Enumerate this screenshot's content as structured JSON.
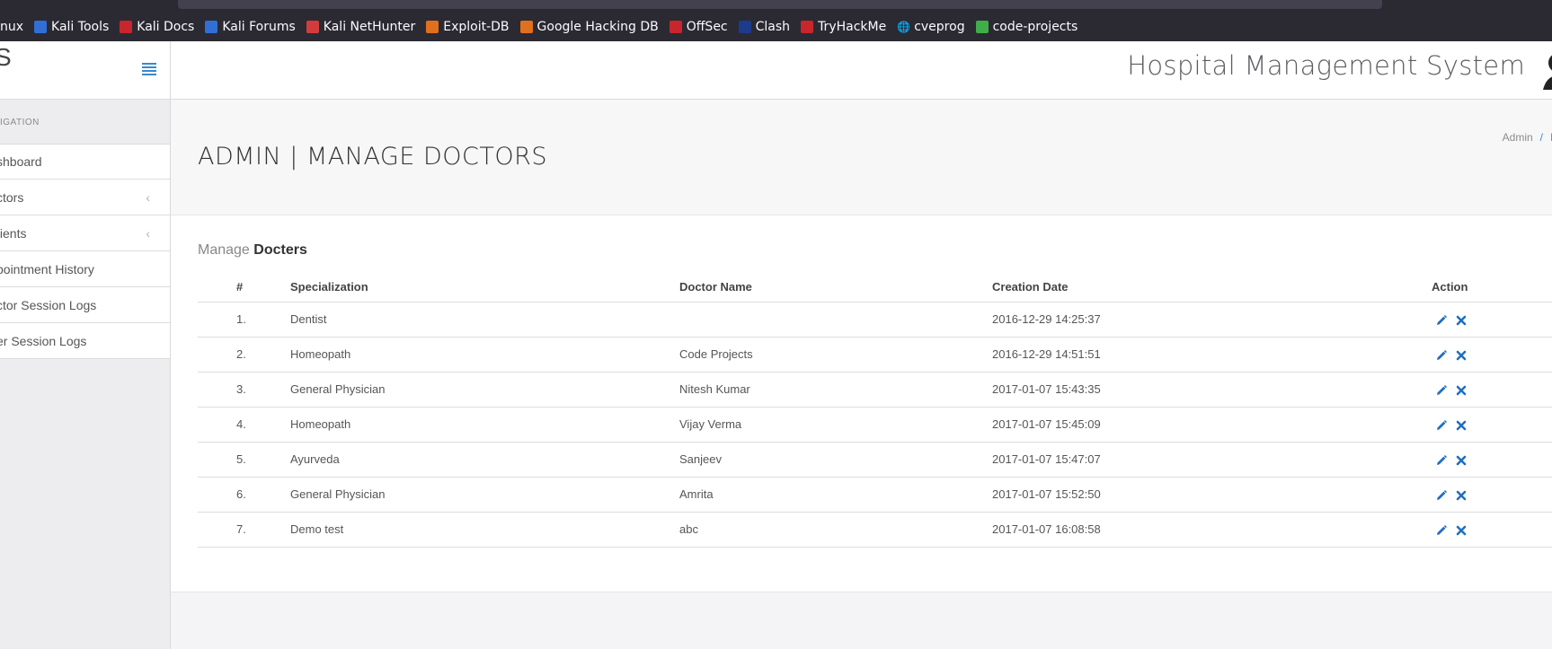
{
  "bookmarks": [
    {
      "label": "nux",
      "icon": "none",
      "color": ""
    },
    {
      "label": "Kali Tools",
      "icon": "kali-tools-icon",
      "color": "#2f6fd6"
    },
    {
      "label": "Kali Docs",
      "icon": "kali-docs-icon",
      "color": "#c9252c"
    },
    {
      "label": "Kali Forums",
      "icon": "kali-forums-icon",
      "color": "#2f6fd6"
    },
    {
      "label": "Kali NetHunter",
      "icon": "kali-nethunter-icon",
      "color": "#d33c3c"
    },
    {
      "label": "Exploit-DB",
      "icon": "exploit-db-icon",
      "color": "#e0701e"
    },
    {
      "label": "Google Hacking DB",
      "icon": "google-hacking-db-icon",
      "color": "#e0701e"
    },
    {
      "label": "OffSec",
      "icon": "offsec-icon",
      "color": "#c9252c"
    },
    {
      "label": "Clash",
      "icon": "clash-icon",
      "color": "#1d3b8c"
    },
    {
      "label": "TryHackMe",
      "icon": "tryhackme-icon",
      "color": "#c9252c"
    },
    {
      "label": "cveprog",
      "icon": "globe-icon",
      "color": "#fbfbfe"
    },
    {
      "label": "code-projects",
      "icon": "code-projects-icon",
      "color": "#3fae49"
    }
  ],
  "sidebar": {
    "brand_letter": "S",
    "nav_heading": "IGATION",
    "items": [
      {
        "label": "shboard",
        "has_chevron": false
      },
      {
        "label": "ctors",
        "has_chevron": true
      },
      {
        "label": "tients",
        "has_chevron": true
      },
      {
        "label": "pointment History",
        "has_chevron": false
      },
      {
        "label": "ctor Session Logs",
        "has_chevron": false
      },
      {
        "label": "er Session Logs",
        "has_chevron": false
      }
    ]
  },
  "header": {
    "app_title": "Hospital Management System"
  },
  "page": {
    "title": "ADMIN | MANAGE DOCTORS",
    "breadcrumb": {
      "first": "Admin",
      "separator": "/",
      "second": "M"
    }
  },
  "panel": {
    "heading_light": "Manage",
    "heading_bold": "Docters"
  },
  "table": {
    "columns": [
      "#",
      "Specialization",
      "Doctor Name",
      "Creation Date",
      "Action"
    ],
    "rows": [
      {
        "num": "1.",
        "specialization": "Dentist",
        "doctor_name": "",
        "created": "2016-12-29 14:25:37"
      },
      {
        "num": "2.",
        "specialization": "Homeopath",
        "doctor_name": "Code Projects",
        "created": "2016-12-29 14:51:51"
      },
      {
        "num": "3.",
        "specialization": "General Physician",
        "doctor_name": "Nitesh Kumar",
        "created": "2017-01-07 15:43:35"
      },
      {
        "num": "4.",
        "specialization": "Homeopath",
        "doctor_name": "Vijay Verma",
        "created": "2017-01-07 15:45:09"
      },
      {
        "num": "5.",
        "specialization": "Ayurveda",
        "doctor_name": "Sanjeev",
        "created": "2017-01-07 15:47:07"
      },
      {
        "num": "6.",
        "specialization": "General Physician",
        "doctor_name": "Amrita",
        "created": "2017-01-07 15:52:50"
      },
      {
        "num": "7.",
        "specialization": "Demo test",
        "doctor_name": "abc",
        "created": "2017-01-07 16:08:58"
      }
    ]
  },
  "colors": {
    "accent": "#3a89c9",
    "action_icon": "#1f6fc0"
  }
}
